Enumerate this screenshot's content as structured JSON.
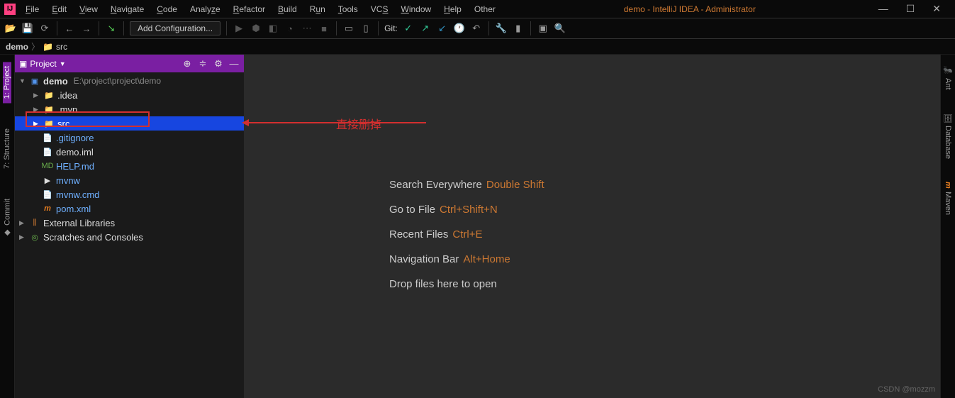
{
  "titlebar": {
    "menus": [
      "File",
      "Edit",
      "View",
      "Navigate",
      "Code",
      "Analyze",
      "Refactor",
      "Build",
      "Run",
      "Tools",
      "VCS",
      "Window",
      "Help",
      "Other"
    ],
    "window_title": "demo - IntelliJ IDEA - Administrator"
  },
  "toolbar": {
    "add_config": "Add Configuration...",
    "git_label": "Git:"
  },
  "breadcrumb": {
    "root": "demo",
    "child": "src"
  },
  "left_tabs": {
    "project": "1: Project",
    "structure": "7: Structure",
    "commit": "Commit"
  },
  "panel": {
    "title": "Project",
    "tree": {
      "root": {
        "name": "demo",
        "path": "E:\\project\\project\\demo"
      },
      "idea": ".idea",
      "mvn": ".mvn",
      "src": "src",
      "gitignore": ".gitignore",
      "demo_iml": "demo.iml",
      "help_md": "HELP.md",
      "mvnw": "mvnw",
      "mvnw_cmd": "mvnw.cmd",
      "pom": "pom.xml",
      "ext_lib": "External Libraries",
      "scratches": "Scratches and Consoles"
    }
  },
  "annotation": {
    "text": "直接删掉"
  },
  "hints": {
    "h1": {
      "label": "Search Everywhere",
      "sc": "Double Shift"
    },
    "h2": {
      "label": "Go to File",
      "sc": "Ctrl+Shift+N"
    },
    "h3": {
      "label": "Recent Files",
      "sc": "Ctrl+E"
    },
    "h4": {
      "label": "Navigation Bar",
      "sc": "Alt+Home"
    },
    "h5": {
      "label": "Drop files here to open",
      "sc": ""
    }
  },
  "right_tabs": {
    "ant": "Ant",
    "database": "Database",
    "maven": "Maven"
  },
  "watermark": "CSDN @mozzm"
}
